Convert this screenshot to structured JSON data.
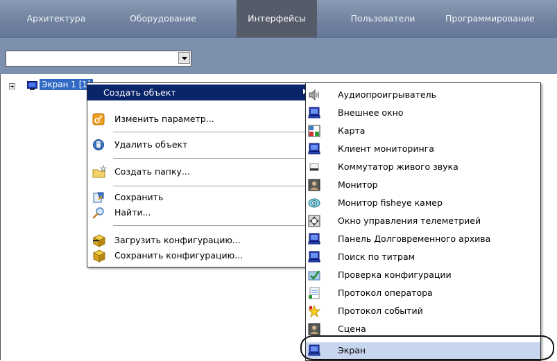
{
  "tabs": [
    {
      "label": "Архитектура",
      "active": false
    },
    {
      "label": "Оборудование",
      "active": false
    },
    {
      "label": "Интерфейсы",
      "active": true
    },
    {
      "label": "Пользователи",
      "active": false
    },
    {
      "label": "Программирование",
      "active": false
    }
  ],
  "toolbar": {
    "object_selector_value": ""
  },
  "tree": {
    "node_label": "Экран 1 [1]"
  },
  "context_menu": {
    "items": [
      {
        "label": "Создать объект",
        "icon": "none",
        "has_submenu": true
      },
      {
        "label": "Изменить параметр...",
        "icon": "edit-parameter-icon"
      },
      {
        "label": "Удалить объект",
        "icon": "delete-object-icon"
      },
      {
        "label": "Создать папку...",
        "icon": "new-folder-icon"
      },
      {
        "label": "Сохранить",
        "icon": "save-icon"
      },
      {
        "label": "Найти...",
        "icon": "search-icon"
      },
      {
        "label": "Загрузить конфигурацию...",
        "icon": "load-configuration-icon"
      },
      {
        "label": "Сохранить конфигурацию...",
        "icon": "save-configuration-icon"
      }
    ]
  },
  "submenu": {
    "items": [
      {
        "label": "Аудиопроигрыватель",
        "icon": "speaker-icon"
      },
      {
        "label": "Внешнее окно",
        "icon": "monitor-icon"
      },
      {
        "label": "Карта",
        "icon": "map-icon"
      },
      {
        "label": "Клиент мониторинга",
        "icon": "monitor-icon"
      },
      {
        "label": "Коммутатор живого звука",
        "icon": "sound-switch-icon"
      },
      {
        "label": "Монитор",
        "icon": "video-monitor-icon"
      },
      {
        "label": "Монитор fisheye камер",
        "icon": "fisheye-icon"
      },
      {
        "label": "Окно управления телеметрией",
        "icon": "telemetry-icon"
      },
      {
        "label": "Панель Долговременного архива",
        "icon": "monitor-icon"
      },
      {
        "label": "Поиск по титрам",
        "icon": "monitor-icon"
      },
      {
        "label": "Проверка конфигурации",
        "icon": "config-check-icon"
      },
      {
        "label": "Протокол оператора",
        "icon": "operator-log-icon"
      },
      {
        "label": "Протокол событий",
        "icon": "event-log-icon"
      },
      {
        "label": "Сцена",
        "icon": "scene-icon"
      },
      {
        "label": "Экран",
        "icon": "screen-icon"
      }
    ]
  },
  "colors": {
    "tab_bar": "#7587a3",
    "active_tab": "#555b69",
    "menu_highlight": "#0a246a",
    "tree_selection": "#316ac5"
  }
}
